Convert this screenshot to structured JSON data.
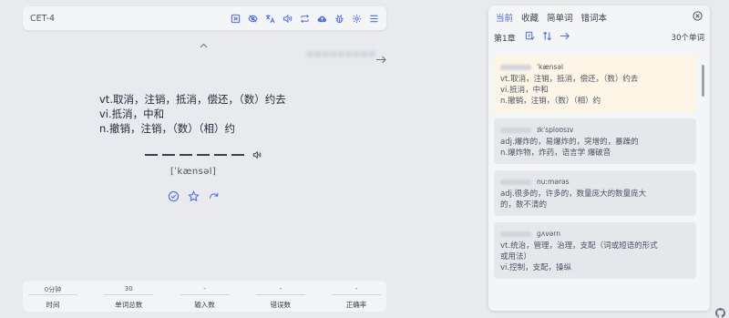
{
  "topbar": {
    "dict": "CET-4",
    "chapter": "第1章"
  },
  "word": {
    "translations": [
      "vt.取消，注销，抵消，偿还，（数）约去",
      "vi.抵消，中和",
      "n.撤销，注销，（数）（相）约"
    ],
    "phonetic": "[ˈkænsəl]"
  },
  "stats": [
    {
      "value": "0分钟",
      "label": "时间"
    },
    {
      "value": "30",
      "label": "单词总数"
    },
    {
      "value": "-",
      "label": "输入数"
    },
    {
      "value": "-",
      "label": "错误数"
    },
    {
      "value": "-",
      "label": "正确率"
    }
  ],
  "panel": {
    "tabs": [
      "当前",
      "收藏",
      "简单词",
      "错词本"
    ],
    "chapter": "第1章",
    "count": "30个单词",
    "cards": [
      {
        "phonetic": "ˈkænsəl",
        "lines": [
          "vt.取消，注销，抵消，偿还，（数）约去",
          "vi.抵消，中和",
          "n.撤销，注销，（数）（相）约"
        ]
      },
      {
        "phonetic": "ɪkˈsploʊsɪv",
        "lines": [
          "adj.爆炸的，易爆炸的，突增的，暴躁的",
          "n.爆炸物，炸药，语言学 爆破音"
        ]
      },
      {
        "phonetic": "nuːmərəs",
        "lines": [
          "adj.很多的，许多的，数量庞大的数量庞大",
          "的，数不清的"
        ]
      },
      {
        "phonetic": "ɡʌvərn",
        "lines": [
          "vt.统治，管理，治理，支配（词或短语的形式",
          "或用法）",
          "vi.控制，支配，操纵"
        ]
      }
    ]
  }
}
